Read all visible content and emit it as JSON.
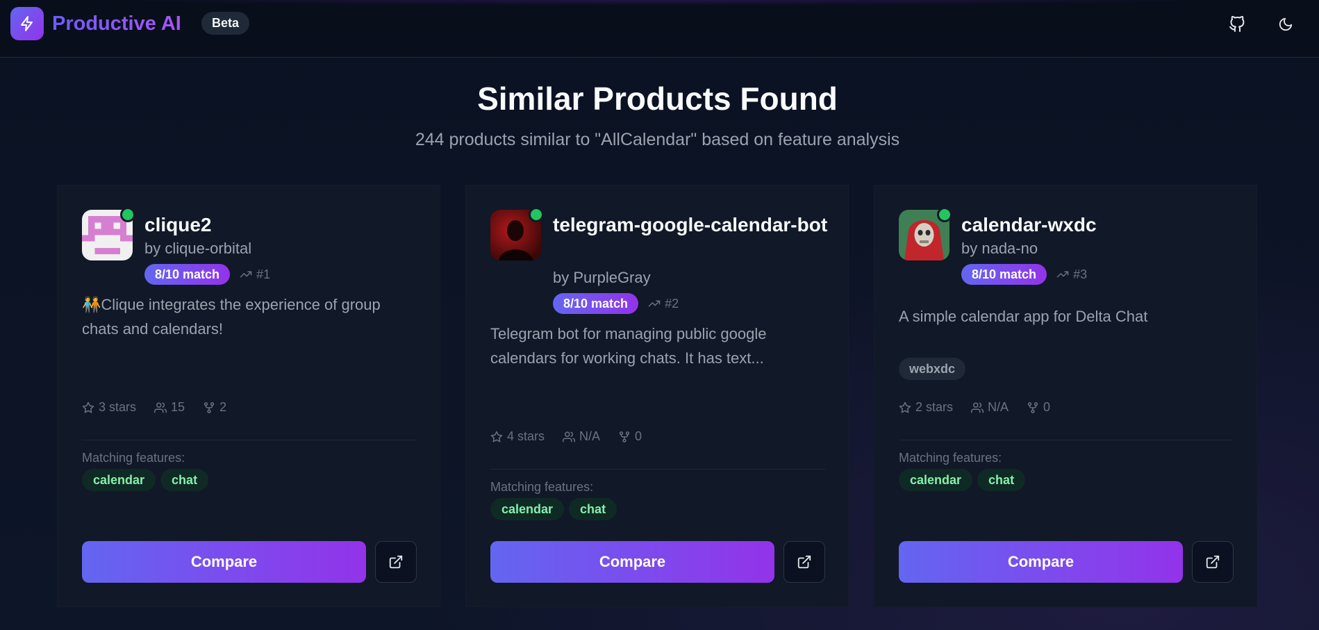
{
  "header": {
    "brand": "Productive AI",
    "badge": "Beta",
    "icons": [
      "zap-icon",
      "github-icon",
      "moon-icon"
    ]
  },
  "page": {
    "title": "Similar Products Found",
    "subtitle": "244 products similar to \"AllCalendar\" based on feature analysis"
  },
  "cards": [
    {
      "name": "clique2",
      "author": "by clique-orbital",
      "match": "8/10 match",
      "rank": "#1",
      "description": "🧑‍🤝‍🧑Clique integrates the experience of group chats and calendars!",
      "stars": "3 stars",
      "users": "15",
      "forks": "2",
      "matching_label": "Matching features:",
      "features": [
        "calendar",
        "chat"
      ],
      "compare_label": "Compare"
    },
    {
      "name": "telegram-google-calendar-bot",
      "author": "by PurpleGray",
      "match": "8/10 match",
      "rank": "#2",
      "description": "Telegram bot for managing public google calendars for working chats. It has text...",
      "stars": "4 stars",
      "users": "N/A",
      "forks": "0",
      "matching_label": "Matching features:",
      "features": [
        "calendar",
        "chat"
      ],
      "compare_label": "Compare"
    },
    {
      "name": "calendar-wxdc",
      "author": "by nada-no",
      "match": "8/10 match",
      "rank": "#3",
      "description": "A simple calendar app for Delta Chat",
      "tag": "webxdc",
      "stars": "2 stars",
      "users": "N/A",
      "forks": "0",
      "matching_label": "Matching features:",
      "features": [
        "calendar",
        "chat"
      ],
      "compare_label": "Compare"
    }
  ],
  "colors": {
    "accent_start": "#6366f1",
    "accent_end": "#9333ea",
    "online": "#22c55e",
    "feature_text": "#86efac"
  }
}
